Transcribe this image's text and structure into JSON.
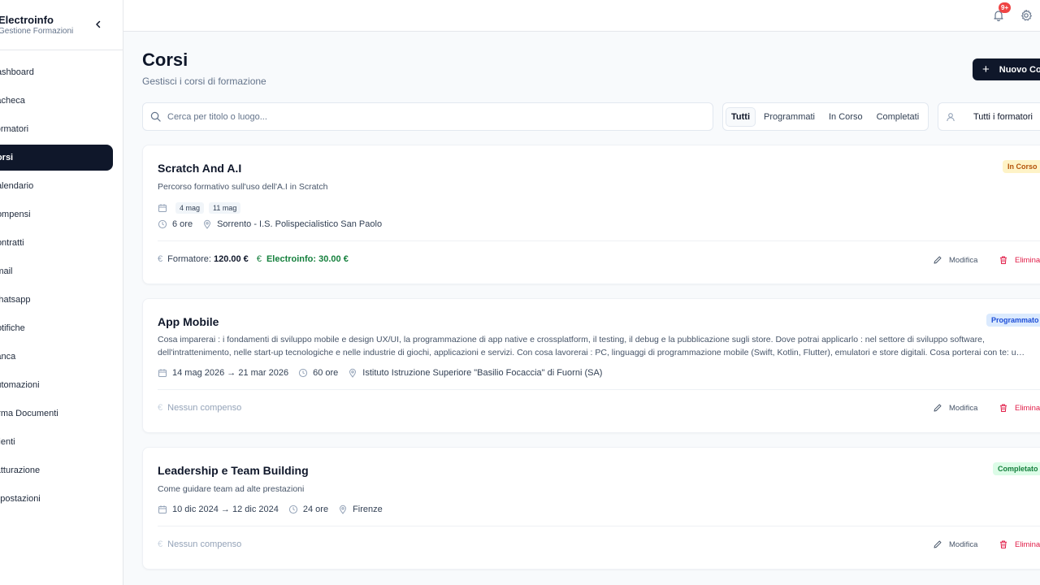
{
  "brand": {
    "name": "Electroinfo",
    "subtitle": "Gestione Formazioni"
  },
  "sidebar": {
    "items": [
      {
        "label": "Dashboard",
        "active": false
      },
      {
        "label": "Bacheca",
        "active": false
      },
      {
        "label": "Formatori",
        "active": false
      },
      {
        "label": "Corsi",
        "active": true
      },
      {
        "label": "Calendario",
        "active": false
      },
      {
        "label": "Compensi",
        "active": false
      },
      {
        "label": "Contratti",
        "active": false
      },
      {
        "label": "Email",
        "active": false
      },
      {
        "label": "Whatsapp",
        "active": false
      },
      {
        "label": "Notifiche",
        "active": false
      },
      {
        "label": "Banca",
        "active": false
      },
      {
        "label": "Automazioni",
        "active": false
      },
      {
        "label": "Firma Documenti",
        "active": false
      },
      {
        "label": "Clienti",
        "active": false
      },
      {
        "label": "Fatturazione",
        "active": false
      },
      {
        "label": "Impostazioni",
        "active": false
      }
    ]
  },
  "topbar": {
    "notification_count": "9+"
  },
  "header": {
    "title": "Corsi",
    "subtitle": "Gestisci i corsi di formazione",
    "new_button": "Nuovo Corso"
  },
  "filters": {
    "search_placeholder": "Cerca per titolo o luogo...",
    "tabs": [
      "Tutti",
      "Programmati",
      "In Corso",
      "Completati"
    ],
    "active_tab": "Tutti",
    "trainer_select": "Tutti i formatori"
  },
  "courses": [
    {
      "title": "Scratch And A.I",
      "description": "Percorso formativo sull'uso dell'A.I in Scratch",
      "status": "In Corso",
      "dates": [
        "4 mag",
        "11 mag"
      ],
      "hours": "6 ore",
      "location": "Sorrento - I.S. Polispecialistico San Paolo",
      "trainer_fee_label": "Formatore:",
      "trainer_fee": "120.00 €",
      "company_fee": "Electroinfo: 30.00 €"
    },
    {
      "title": "App Mobile",
      "description": "Cosa imparerai : i fondamenti di sviluppo mobile e design UX/UI, la programmazione di app native e crossplatform, il testing, il debug e la pubblicazione sugli store. Dove potrai applicarlo : nel settore di sviluppo software, dell'intrattenimento, nelle start-up tecnologiche e nelle industrie di giochi, applicazioni e servizi. Con cosa lavorerai : PC, linguaggi di programmazione mobile (Swift, Kotlin, Flutter), emulatori e store digitali. Cosa porterai con te: un portfolio di progetti.",
      "status": "Programmato",
      "date_range": "14 mag 2026 → 21 mar 2026",
      "hours": "60 ore",
      "location": "Istituto Istruzione Superiore \"Basilio Focaccia\" di Fuorni (SA)",
      "no_compensation": "Nessun compenso"
    },
    {
      "title": "Leadership e Team Building",
      "description": "Come guidare team ad alte prestazioni",
      "status": "Completato",
      "date_range": "10 dic 2024 → 12 dic 2024",
      "hours": "24 ore",
      "location": "Firenze",
      "no_compensation": "Nessun compenso"
    }
  ],
  "actions": {
    "edit": "Modifica",
    "delete": "Elimina"
  },
  "colors": {
    "primary": "#0f172a",
    "status_in_progress_bg": "#fef3c7",
    "status_in_progress_text": "#b45309",
    "status_scheduled_bg": "#dbeafe",
    "status_scheduled_text": "#1d4ed8",
    "status_completed_bg": "#dcfce7",
    "status_completed_text": "#15803d",
    "danger": "#e11d48",
    "success": "#15803d"
  }
}
